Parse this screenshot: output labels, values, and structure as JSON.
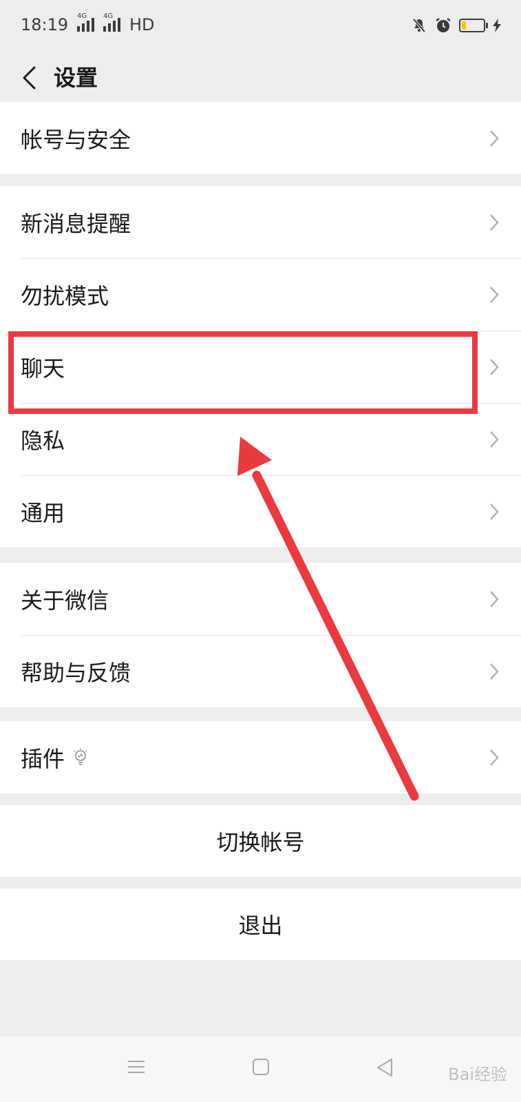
{
  "status_bar": {
    "time": "18:19",
    "network1": "4G",
    "network2": "4G",
    "hd": "HD",
    "battery_level": 0.2
  },
  "header": {
    "title": "设置"
  },
  "groups": [
    {
      "items": [
        {
          "label": "帐号与安全"
        }
      ]
    },
    {
      "items": [
        {
          "label": "新消息提醒"
        },
        {
          "label": "勿扰模式"
        },
        {
          "label": "聊天"
        },
        {
          "label": "隐私"
        },
        {
          "label": "通用"
        }
      ]
    },
    {
      "items": [
        {
          "label": "关于微信"
        },
        {
          "label": "帮助与反馈"
        }
      ]
    },
    {
      "items": [
        {
          "label": "插件"
        }
      ]
    }
  ],
  "actions": {
    "switch_account": "切换帐号",
    "logout": "退出"
  },
  "colors": {
    "background": "#ededed",
    "annotation_red": "#ea3a40",
    "battery_yellow": "#f6c400"
  },
  "watermark": "Bai经验"
}
